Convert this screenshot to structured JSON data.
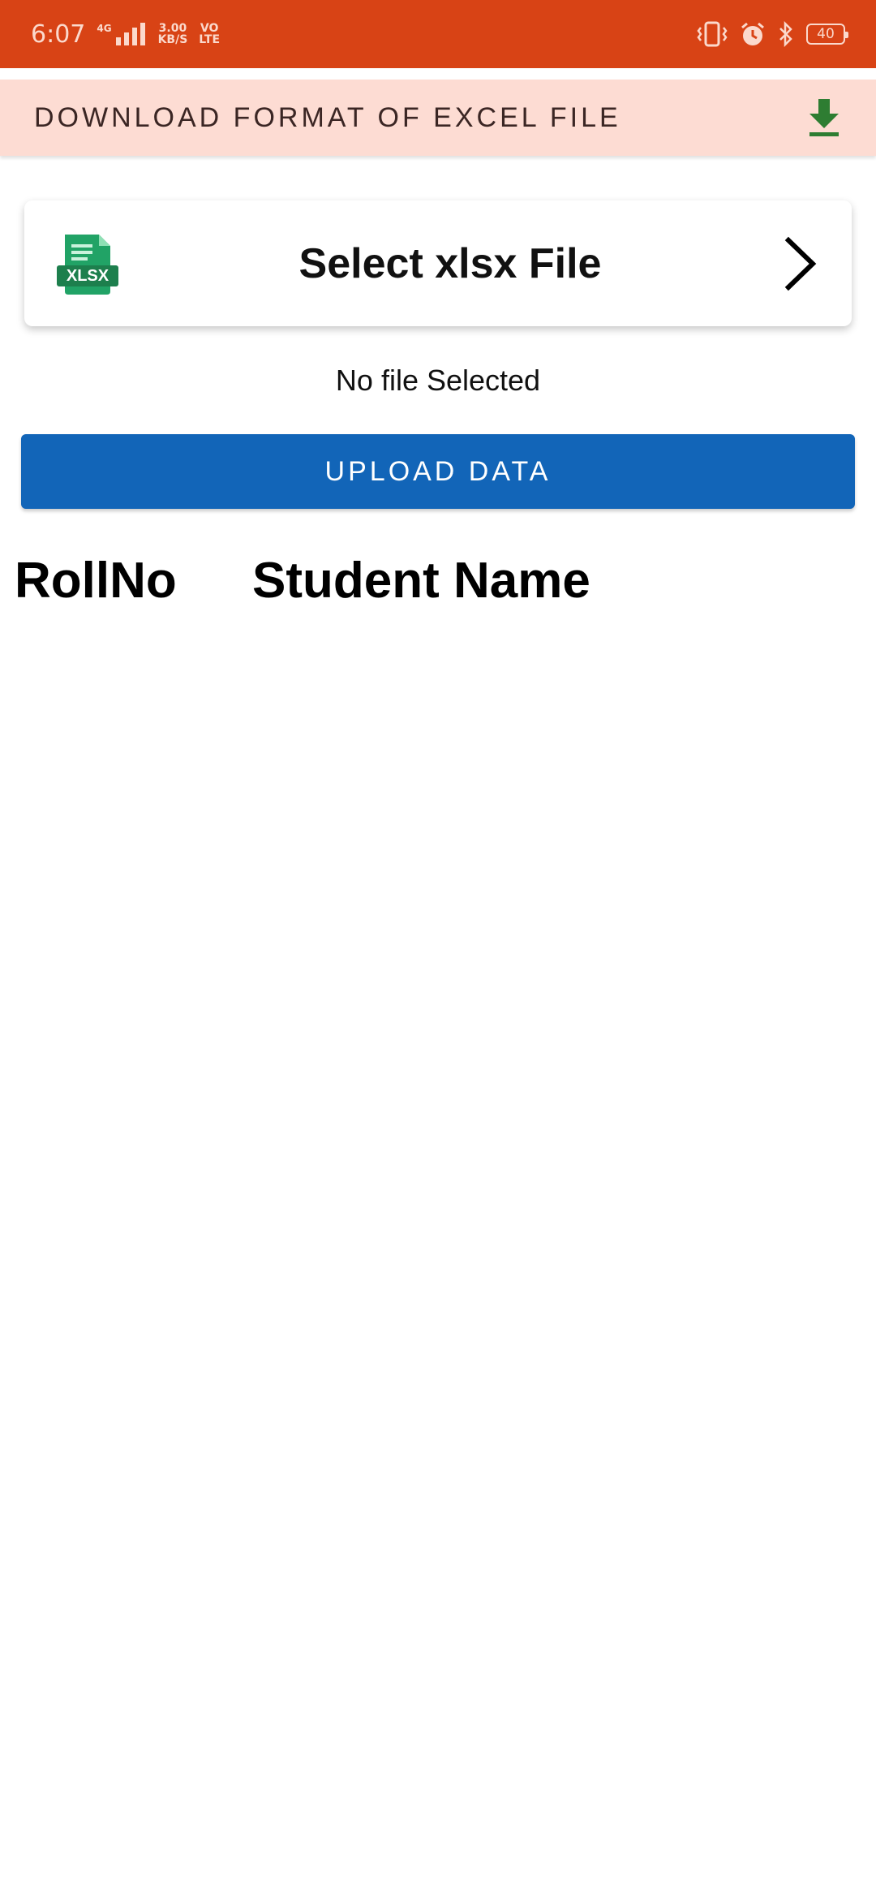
{
  "status_bar": {
    "time": "6:07",
    "network_type": "4G",
    "data_speed_value": "3.00",
    "data_speed_unit": "KB/S",
    "volte_top": "VO",
    "volte_bottom": "LTE",
    "battery_level": "40",
    "icons": [
      "signal-icon",
      "vibrate-icon",
      "alarm-icon",
      "bluetooth-icon",
      "battery-icon"
    ]
  },
  "download_bar": {
    "label": "DOWNLOAD FORMAT OF EXCEL FILE",
    "icon": "download-icon",
    "icon_color": "#2e7d32"
  },
  "select_file": {
    "icon_label": "XLSX",
    "label": "Select xlsx File",
    "icon": "chevron-right-icon"
  },
  "file_status": "No file Selected",
  "upload_button": {
    "label": "UPLOAD DATA",
    "color": "#1265b8"
  },
  "table": {
    "columns": [
      "RollNo",
      "Student Name"
    ]
  },
  "colors": {
    "status_bar": "#d84315",
    "download_bar": "#fddcd3",
    "excel_green": "#21a366"
  }
}
